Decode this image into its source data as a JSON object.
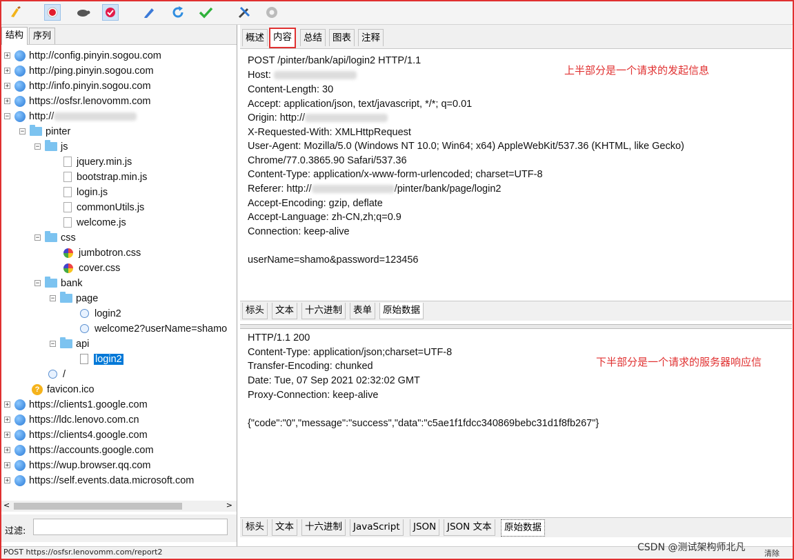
{
  "toolbar": {
    "icons": [
      "broom-icon",
      "record-icon",
      "turtle-icon",
      "check-badge-icon",
      "pencil-icon",
      "refresh-icon",
      "checkmark-icon",
      "tools-icon",
      "gear-icon"
    ]
  },
  "left_tabs": [
    "结构",
    "序列"
  ],
  "tree": {
    "hosts_top": [
      "http://config.pinyin.sogou.com",
      "http://ping.pinyin.sogou.com",
      "http://info.pinyin.sogou.com",
      "https://osfsr.lenovomm.com"
    ],
    "host_main": "http://",
    "pinter": "pinter",
    "js": "js",
    "js_files": [
      "jquery.min.js",
      "bootstrap.min.js",
      "login.js",
      "commonUtils.js",
      "welcome.js"
    ],
    "css": "css",
    "css_files": [
      "jumbotron.css",
      "cover.css"
    ],
    "bank": "bank",
    "page": "page",
    "page_files": [
      "login2",
      "welcome2?userName=shamo"
    ],
    "api": "api",
    "api_file": "login2",
    "root": "/",
    "favicon": "favicon.ico",
    "hosts_bottom": [
      "https://clients1.google.com",
      "https://ldc.lenovo.com.cn",
      "https://clients4.google.com",
      "https://accounts.google.com",
      "https://wup.browser.qq.com",
      "https://self.events.data.microsoft.com"
    ]
  },
  "filter_label": "过滤:",
  "status_text": "POST https://osfsr.lenovomm.com/report2",
  "right_tabs": [
    "概述",
    "内容",
    "总结",
    "图表",
    "注释"
  ],
  "request": {
    "lines": [
      "POST /pinter/bank/api/login2 HTTP/1.1",
      "Host: ",
      "Content-Length: 30",
      "Accept: application/json, text/javascript, */*; q=0.01",
      "Origin: http://",
      "X-Requested-With: XMLHttpRequest",
      "User-Agent: Mozilla/5.0 (Windows NT 10.0; Win64; x64) AppleWebKit/537.36 (KHTML, like Gecko)",
      "Chrome/77.0.3865.90 Safari/537.36",
      "Content-Type: application/x-www-form-urlencoded; charset=UTF-8",
      "Referer: http://",
      "Accept-Encoding: gzip, deflate",
      "Accept-Language: zh-CN,zh;q=0.9",
      "Connection: keep-alive",
      "",
      "userName=shamo&password=123456"
    ],
    "referer_tail": "/pinter/bank/page/login2",
    "note": "上半部分是一个请求的发起信息",
    "tabs": [
      "标头",
      "文本",
      "十六进制",
      "表单",
      "原始数据"
    ]
  },
  "response": {
    "lines": [
      "HTTP/1.1 200",
      "Content-Type: application/json;charset=UTF-8",
      "Transfer-Encoding: chunked",
      "Date: Tue, 07 Sep 2021 02:32:02 GMT",
      "Proxy-Connection: keep-alive",
      "",
      "{\"code\":\"0\",\"message\":\"success\",\"data\":\"c5ae1f1fdcc340869bebc31d1f8fb267\"}"
    ],
    "note": "下半部分是一个请求的服务器响应信",
    "tabs": [
      "标头",
      "文本",
      "十六进制",
      "JavaScript",
      "JSON",
      "JSON 文本",
      "原始数据"
    ]
  },
  "watermark": "CSDN @测试架构师北凡",
  "corner_button": "清除"
}
